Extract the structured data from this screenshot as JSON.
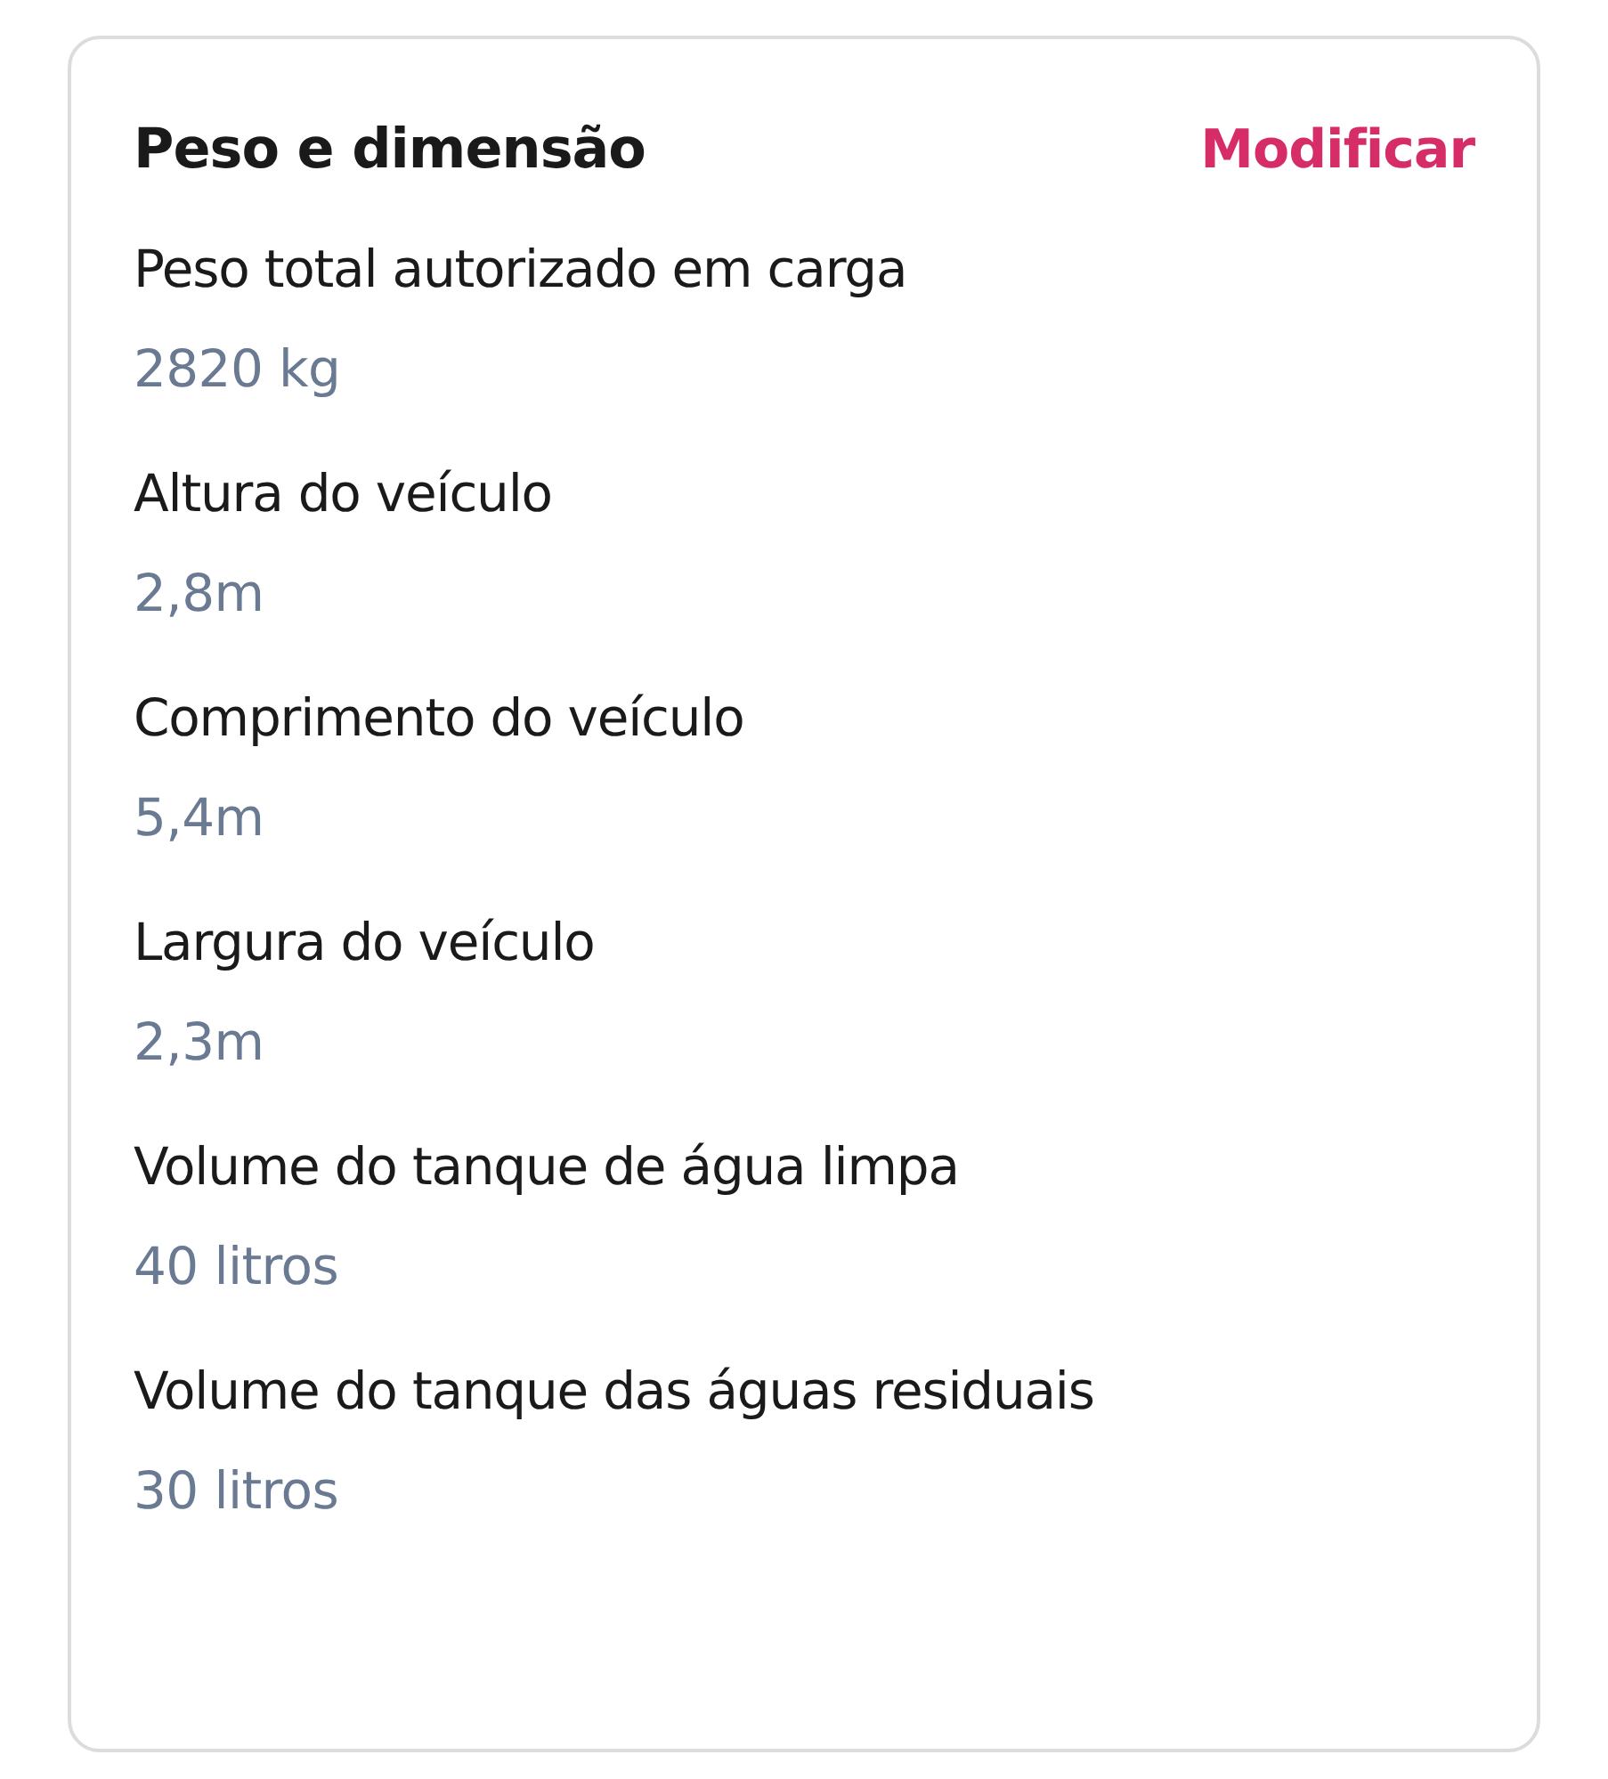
{
  "card": {
    "title": "Peso e dimensão",
    "action": "Modificar"
  },
  "specs": [
    {
      "label": "Peso total autorizado em carga",
      "value": "2820 kg"
    },
    {
      "label": "Altura do veículo",
      "value": "2,8m"
    },
    {
      "label": "Comprimento do veículo",
      "value": "5,4m"
    },
    {
      "label": "Largura do veículo",
      "value": "2,3m"
    },
    {
      "label": "Volume do tanque de água limpa",
      "value": "40 litros"
    },
    {
      "label": "Volume do tanque das águas residuais",
      "value": "30 litros"
    }
  ]
}
